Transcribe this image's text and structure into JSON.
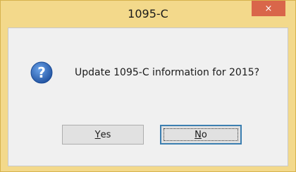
{
  "window": {
    "title": "1095-C",
    "close_glyph": "×"
  },
  "dialog": {
    "icon": "question-icon",
    "message": "Update 1095-C information for 2015?"
  },
  "buttons": {
    "yes": {
      "mnemonic": "Y",
      "rest": "es"
    },
    "no": {
      "mnemonic": "N",
      "rest": "o"
    }
  },
  "colors": {
    "frame": "#f3d98b",
    "close": "#d9664a",
    "client": "#f0f0f0",
    "focus_border": "#3c7fb1",
    "icon_blue": "#2a63b8"
  }
}
